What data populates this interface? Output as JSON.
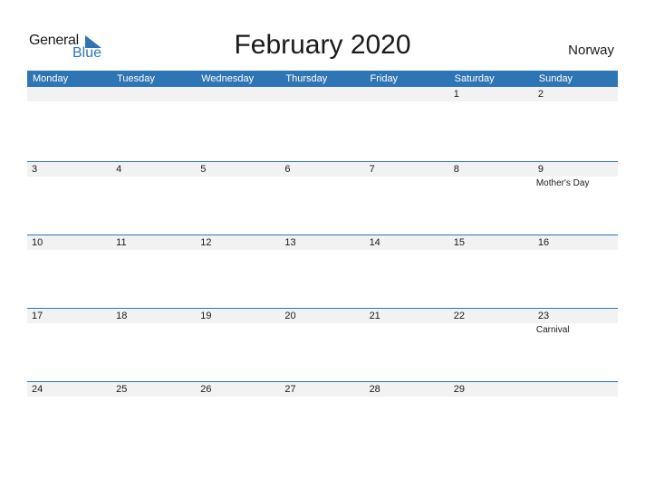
{
  "logo": {
    "line1": "General",
    "line2": "Blue"
  },
  "title": "February 2020",
  "country": "Norway",
  "colors": {
    "accent": "#2e75b6",
    "strip": "#f2f2f2"
  },
  "weekdays": [
    "Monday",
    "Tuesday",
    "Wednesday",
    "Thursday",
    "Friday",
    "Saturday",
    "Sunday"
  ],
  "weeks": [
    {
      "days": [
        {
          "n": ""
        },
        {
          "n": ""
        },
        {
          "n": ""
        },
        {
          "n": ""
        },
        {
          "n": ""
        },
        {
          "n": "1"
        },
        {
          "n": "2"
        }
      ]
    },
    {
      "days": [
        {
          "n": "3"
        },
        {
          "n": "4"
        },
        {
          "n": "5"
        },
        {
          "n": "6"
        },
        {
          "n": "7"
        },
        {
          "n": "8"
        },
        {
          "n": "9",
          "event": "Mother's Day"
        }
      ]
    },
    {
      "days": [
        {
          "n": "10"
        },
        {
          "n": "11"
        },
        {
          "n": "12"
        },
        {
          "n": "13"
        },
        {
          "n": "14"
        },
        {
          "n": "15"
        },
        {
          "n": "16"
        }
      ]
    },
    {
      "days": [
        {
          "n": "17"
        },
        {
          "n": "18"
        },
        {
          "n": "19"
        },
        {
          "n": "20"
        },
        {
          "n": "21"
        },
        {
          "n": "22"
        },
        {
          "n": "23",
          "event": "Carnival"
        }
      ]
    },
    {
      "days": [
        {
          "n": "24"
        },
        {
          "n": "25"
        },
        {
          "n": "26"
        },
        {
          "n": "27"
        },
        {
          "n": "28"
        },
        {
          "n": "29"
        },
        {
          "n": ""
        }
      ]
    }
  ]
}
